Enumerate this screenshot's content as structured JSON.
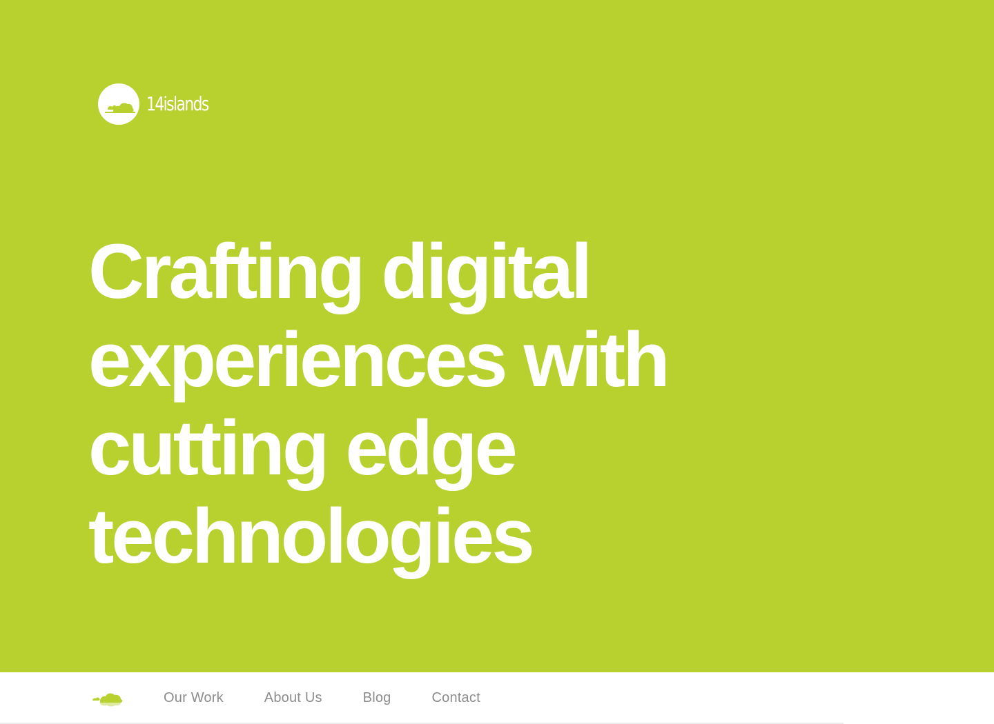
{
  "colors": {
    "brand_green": "#b8d12f",
    "text_on_brand": "#ffffff",
    "nav_background": "#ffffff",
    "nav_text": "#8c8c8c"
  },
  "logo": {
    "icon": "islands-badge-icon",
    "wordmark": "14islands"
  },
  "hero": {
    "headline_lines": [
      "Crafting digital",
      "experiences with",
      "cutting edge",
      "technologies"
    ]
  },
  "nav": {
    "logo_icon": "islands-mark-icon",
    "items": [
      {
        "label": "Our Work"
      },
      {
        "label": "About Us"
      },
      {
        "label": "Blog"
      },
      {
        "label": "Contact"
      }
    ]
  }
}
